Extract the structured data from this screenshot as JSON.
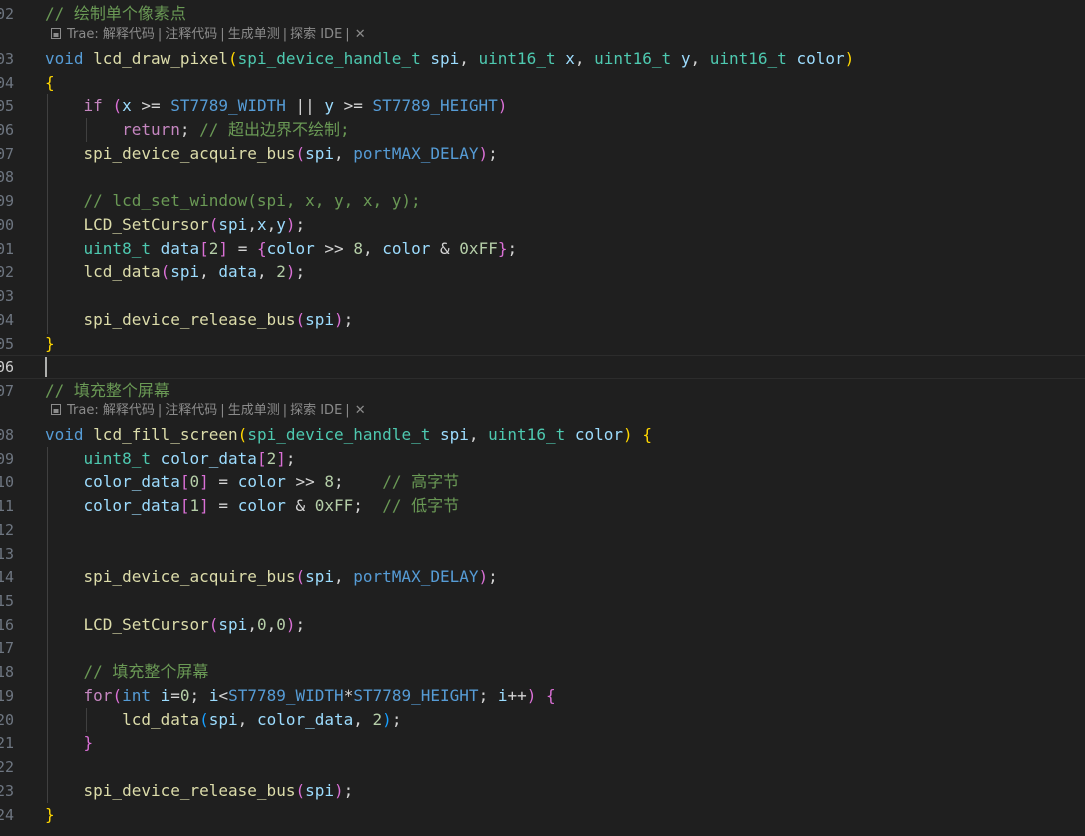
{
  "editor": {
    "hints": [
      {
        "source": "Trae:",
        "actions": [
          "解释代码",
          "注释代码",
          "生成单测",
          "探索 IDE"
        ],
        "close_glyph": "✕"
      },
      {
        "source": "Trae:",
        "actions": [
          "解释代码",
          "注释代码",
          "生成单测",
          "探索 IDE"
        ],
        "close_glyph": "✕"
      }
    ],
    "separator": "|",
    "lines": [
      {
        "no": "02",
        "tokens": [
          [
            "cm",
            "// 绘制单个像素点"
          ]
        ]
      },
      {
        "no": "03",
        "tokens": [
          [
            "kw",
            "void"
          ],
          [
            "pu",
            " "
          ],
          [
            "fn",
            "lcd_draw_pixel"
          ],
          [
            "b1",
            "("
          ],
          [
            "ty",
            "spi_device_handle_t"
          ],
          [
            "pu",
            " "
          ],
          [
            "var",
            "spi"
          ],
          [
            "pu",
            ", "
          ],
          [
            "ty",
            "uint16_t"
          ],
          [
            "pu",
            " "
          ],
          [
            "var",
            "x"
          ],
          [
            "pu",
            ", "
          ],
          [
            "ty",
            "uint16_t"
          ],
          [
            "pu",
            " "
          ],
          [
            "var",
            "y"
          ],
          [
            "pu",
            ", "
          ],
          [
            "ty",
            "uint16_t"
          ],
          [
            "pu",
            " "
          ],
          [
            "var",
            "color"
          ],
          [
            "b1",
            ")"
          ]
        ]
      },
      {
        "no": "04",
        "tokens": [
          [
            "b1",
            "{"
          ]
        ]
      },
      {
        "no": "05",
        "tokens": [
          [
            "pu",
            "    "
          ],
          [
            "ctl",
            "if"
          ],
          [
            "pu",
            " "
          ],
          [
            "b2",
            "("
          ],
          [
            "var",
            "x"
          ],
          [
            "op",
            " >= "
          ],
          [
            "mac",
            "ST7789_WIDTH"
          ],
          [
            "op",
            " || "
          ],
          [
            "var",
            "y"
          ],
          [
            "op",
            " >= "
          ],
          [
            "mac",
            "ST7789_HEIGHT"
          ],
          [
            "b2",
            ")"
          ]
        ]
      },
      {
        "no": "06",
        "tokens": [
          [
            "pu",
            "        "
          ],
          [
            "ctl",
            "return"
          ],
          [
            "pu",
            "; "
          ],
          [
            "cm",
            "// 超出边界不绘制;"
          ]
        ]
      },
      {
        "no": "07",
        "tokens": [
          [
            "pu",
            "    "
          ],
          [
            "fn",
            "spi_device_acquire_bus"
          ],
          [
            "b2",
            "("
          ],
          [
            "var",
            "spi"
          ],
          [
            "pu",
            ", "
          ],
          [
            "mac",
            "portMAX_DELAY"
          ],
          [
            "b2",
            ")"
          ],
          [
            "pu",
            ";"
          ]
        ]
      },
      {
        "no": "08",
        "tokens": []
      },
      {
        "no": "09",
        "tokens": [
          [
            "pu",
            "    "
          ],
          [
            "cm",
            "// lcd_set_window(spi, x, y, x, y);"
          ]
        ]
      },
      {
        "no": "00",
        "tokens": [
          [
            "pu",
            "    "
          ],
          [
            "fn",
            "LCD_SetCursor"
          ],
          [
            "b2",
            "("
          ],
          [
            "var",
            "spi"
          ],
          [
            "pu",
            ","
          ],
          [
            "var",
            "x"
          ],
          [
            "pu",
            ","
          ],
          [
            "var",
            "y"
          ],
          [
            "b2",
            ")"
          ],
          [
            "pu",
            ";"
          ]
        ]
      },
      {
        "no": "01",
        "tokens": [
          [
            "pu",
            "    "
          ],
          [
            "ty",
            "uint8_t"
          ],
          [
            "pu",
            " "
          ],
          [
            "var",
            "data"
          ],
          [
            "b2",
            "["
          ],
          [
            "num",
            "2"
          ],
          [
            "b2",
            "]"
          ],
          [
            "op",
            " = "
          ],
          [
            "b2",
            "{"
          ],
          [
            "var",
            "color"
          ],
          [
            "op",
            " >> "
          ],
          [
            "num",
            "8"
          ],
          [
            "pu",
            ", "
          ],
          [
            "var",
            "color"
          ],
          [
            "op",
            " & "
          ],
          [
            "num",
            "0xFF"
          ],
          [
            "b2",
            "}"
          ],
          [
            "pu",
            ";"
          ]
        ]
      },
      {
        "no": "02",
        "tokens": [
          [
            "pu",
            "    "
          ],
          [
            "fn",
            "lcd_data"
          ],
          [
            "b2",
            "("
          ],
          [
            "var",
            "spi"
          ],
          [
            "pu",
            ", "
          ],
          [
            "var",
            "data"
          ],
          [
            "pu",
            ", "
          ],
          [
            "num",
            "2"
          ],
          [
            "b2",
            ")"
          ],
          [
            "pu",
            ";"
          ]
        ]
      },
      {
        "no": "03",
        "tokens": []
      },
      {
        "no": "04",
        "tokens": [
          [
            "pu",
            "    "
          ],
          [
            "fn",
            "spi_device_release_bus"
          ],
          [
            "b2",
            "("
          ],
          [
            "var",
            "spi"
          ],
          [
            "b2",
            ")"
          ],
          [
            "pu",
            ";"
          ]
        ]
      },
      {
        "no": "05",
        "tokens": [
          [
            "b1",
            "}"
          ]
        ]
      },
      {
        "no": "06",
        "tokens": [],
        "active": true
      },
      {
        "no": "07",
        "tokens": [
          [
            "cm",
            "// 填充整个屏幕"
          ]
        ]
      },
      {
        "no": "08",
        "tokens": [
          [
            "kw",
            "void"
          ],
          [
            "pu",
            " "
          ],
          [
            "fn",
            "lcd_fill_screen"
          ],
          [
            "b1",
            "("
          ],
          [
            "ty",
            "spi_device_handle_t"
          ],
          [
            "pu",
            " "
          ],
          [
            "var",
            "spi"
          ],
          [
            "pu",
            ", "
          ],
          [
            "ty",
            "uint16_t"
          ],
          [
            "pu",
            " "
          ],
          [
            "var",
            "color"
          ],
          [
            "b1",
            ")"
          ],
          [
            "pu",
            " "
          ],
          [
            "b1",
            "{"
          ]
        ]
      },
      {
        "no": "09",
        "tokens": [
          [
            "pu",
            "    "
          ],
          [
            "ty",
            "uint8_t"
          ],
          [
            "pu",
            " "
          ],
          [
            "var",
            "color_data"
          ],
          [
            "b2",
            "["
          ],
          [
            "num",
            "2"
          ],
          [
            "b2",
            "]"
          ],
          [
            "pu",
            ";"
          ]
        ]
      },
      {
        "no": "10",
        "tokens": [
          [
            "pu",
            "    "
          ],
          [
            "var",
            "color_data"
          ],
          [
            "b2",
            "["
          ],
          [
            "num",
            "0"
          ],
          [
            "b2",
            "]"
          ],
          [
            "op",
            " = "
          ],
          [
            "var",
            "color"
          ],
          [
            "op",
            " >> "
          ],
          [
            "num",
            "8"
          ],
          [
            "pu",
            ";    "
          ],
          [
            "cm",
            "// 高字节"
          ]
        ]
      },
      {
        "no": "11",
        "tokens": [
          [
            "pu",
            "    "
          ],
          [
            "var",
            "color_data"
          ],
          [
            "b2",
            "["
          ],
          [
            "num",
            "1"
          ],
          [
            "b2",
            "]"
          ],
          [
            "op",
            " = "
          ],
          [
            "var",
            "color"
          ],
          [
            "op",
            " & "
          ],
          [
            "num",
            "0xFF"
          ],
          [
            "pu",
            ";  "
          ],
          [
            "cm",
            "// 低字节"
          ]
        ]
      },
      {
        "no": "12",
        "tokens": []
      },
      {
        "no": "13",
        "tokens": []
      },
      {
        "no": "14",
        "tokens": [
          [
            "pu",
            "    "
          ],
          [
            "fn",
            "spi_device_acquire_bus"
          ],
          [
            "b2",
            "("
          ],
          [
            "var",
            "spi"
          ],
          [
            "pu",
            ", "
          ],
          [
            "mac",
            "portMAX_DELAY"
          ],
          [
            "b2",
            ")"
          ],
          [
            "pu",
            ";"
          ]
        ]
      },
      {
        "no": "15",
        "tokens": []
      },
      {
        "no": "16",
        "tokens": [
          [
            "pu",
            "    "
          ],
          [
            "fn",
            "LCD_SetCursor"
          ],
          [
            "b2",
            "("
          ],
          [
            "var",
            "spi"
          ],
          [
            "pu",
            ","
          ],
          [
            "num",
            "0"
          ],
          [
            "pu",
            ","
          ],
          [
            "num",
            "0"
          ],
          [
            "b2",
            ")"
          ],
          [
            "pu",
            ";"
          ]
        ]
      },
      {
        "no": "17",
        "tokens": []
      },
      {
        "no": "18",
        "tokens": [
          [
            "pu",
            "    "
          ],
          [
            "cm",
            "// 填充整个屏幕"
          ]
        ]
      },
      {
        "no": "19",
        "tokens": [
          [
            "pu",
            "    "
          ],
          [
            "ctl",
            "for"
          ],
          [
            "b2",
            "("
          ],
          [
            "kw",
            "int"
          ],
          [
            "pu",
            " "
          ],
          [
            "var",
            "i"
          ],
          [
            "op",
            "="
          ],
          [
            "num",
            "0"
          ],
          [
            "pu",
            "; "
          ],
          [
            "var",
            "i"
          ],
          [
            "op",
            "<"
          ],
          [
            "mac",
            "ST7789_WIDTH"
          ],
          [
            "op",
            "*"
          ],
          [
            "mac",
            "ST7789_HEIGHT"
          ],
          [
            "pu",
            "; "
          ],
          [
            "var",
            "i"
          ],
          [
            "op",
            "++"
          ],
          [
            "b2",
            ")"
          ],
          [
            "pu",
            " "
          ],
          [
            "b2",
            "{"
          ]
        ]
      },
      {
        "no": "20",
        "tokens": [
          [
            "pu",
            "        "
          ],
          [
            "fn",
            "lcd_data"
          ],
          [
            "b3",
            "("
          ],
          [
            "var",
            "spi"
          ],
          [
            "pu",
            ", "
          ],
          [
            "var",
            "color_data"
          ],
          [
            "pu",
            ", "
          ],
          [
            "num",
            "2"
          ],
          [
            "b3",
            ")"
          ],
          [
            "pu",
            ";"
          ]
        ]
      },
      {
        "no": "21",
        "tokens": [
          [
            "pu",
            "    "
          ],
          [
            "b2",
            "}"
          ]
        ]
      },
      {
        "no": "22",
        "tokens": []
      },
      {
        "no": "23",
        "tokens": [
          [
            "pu",
            "    "
          ],
          [
            "fn",
            "spi_device_release_bus"
          ],
          [
            "b2",
            "("
          ],
          [
            "var",
            "spi"
          ],
          [
            "b2",
            ")"
          ],
          [
            "pu",
            ";"
          ]
        ]
      },
      {
        "no": "24",
        "tokens": [
          [
            "b1",
            "}"
          ]
        ]
      }
    ]
  }
}
